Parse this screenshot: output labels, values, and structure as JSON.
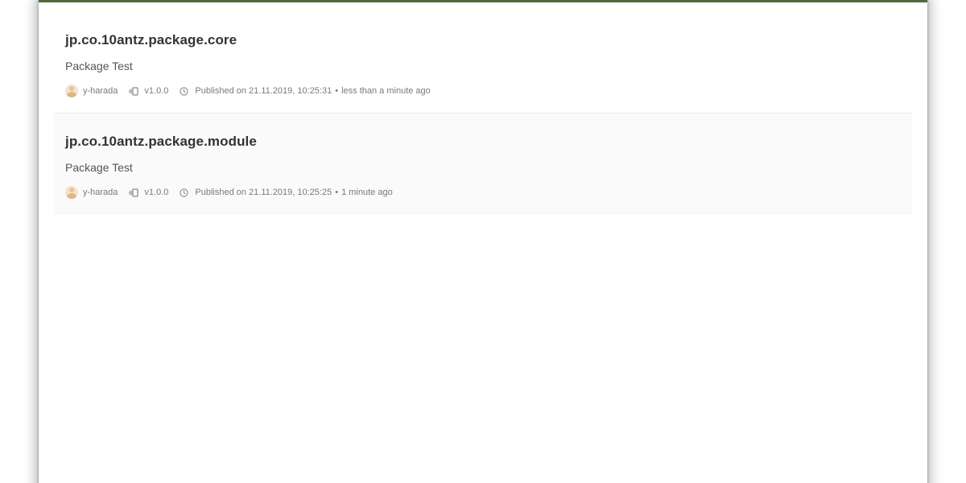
{
  "packages": [
    {
      "name": "jp.co.10antz.package.core",
      "description": "Package Test",
      "author": "y-harada",
      "version": "v1.0.0",
      "published": "Published on 21.11.2019, 10:25:31",
      "separator": "•",
      "relative_time": "less than a minute ago"
    },
    {
      "name": "jp.co.10antz.package.module",
      "description": "Package Test",
      "author": "y-harada",
      "version": "v1.0.0",
      "published": "Published on 21.11.2019, 10:25:25",
      "separator": "•",
      "relative_time": "1 minute ago"
    }
  ],
  "icons": {
    "avatar": "user-avatar",
    "version": "versions-icon",
    "time": "clock-icon"
  },
  "colors": {
    "top_bar": "#4e6b3e",
    "title": "#333333",
    "meta": "#7a7a7a",
    "alt_row": "#fafafa"
  }
}
